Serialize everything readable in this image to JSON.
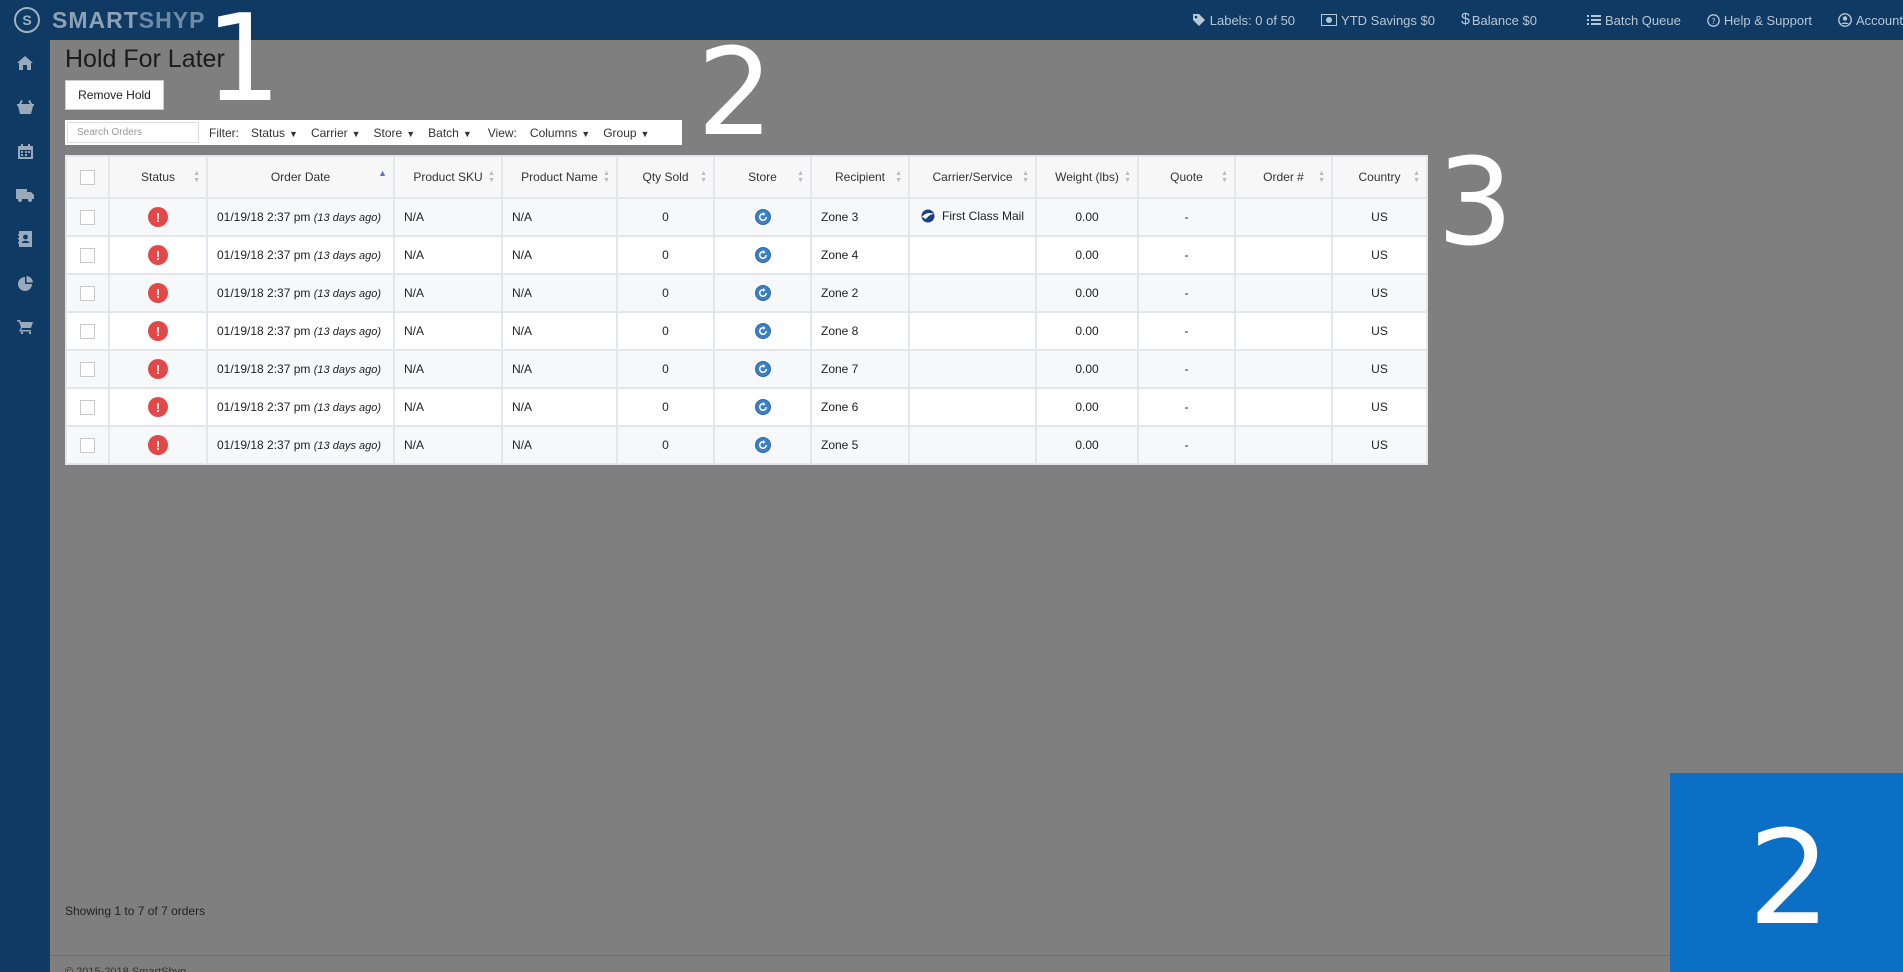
{
  "app": {
    "logo_word1": "SMART",
    "logo_word2": "SHYP"
  },
  "topbar": {
    "labels": "Labels: 0 of 50",
    "ytd_savings": "YTD Savings $0",
    "balance": "Balance $0",
    "batch_queue": "Batch Queue",
    "help": "Help & Support",
    "account": "Account"
  },
  "sidenav": {
    "items": [
      "home-icon",
      "basket-icon",
      "calendar-icon",
      "truck-icon",
      "contacts-icon",
      "pie-chart-icon",
      "cart-icon"
    ]
  },
  "page": {
    "title": "Hold For Later",
    "remove_hold": "Remove Hold"
  },
  "filter": {
    "search_placeholder": "Search Orders",
    "filter_label": "Filter:",
    "status": "Status",
    "carrier": "Carrier",
    "store": "Store",
    "batch": "Batch",
    "view_label": "View:",
    "columns": "Columns",
    "group": "Group"
  },
  "table": {
    "headers": [
      "Status",
      "Order Date",
      "Product SKU",
      "Product Name",
      "Qty Sold",
      "Store",
      "Recipient",
      "Carrier/Service",
      "Weight (lbs)",
      "Quote",
      "Order #",
      "Country"
    ],
    "rows": [
      {
        "date": "01/19/18 2:37 pm",
        "ago": "(13 days ago)",
        "sku": "N/A",
        "name": "N/A",
        "qty": "0",
        "recipient": "Zone 3",
        "carrier": "First Class Mail",
        "weight": "0.00",
        "quote": "-",
        "order": "",
        "country": "US"
      },
      {
        "date": "01/19/18 2:37 pm",
        "ago": "(13 days ago)",
        "sku": "N/A",
        "name": "N/A",
        "qty": "0",
        "recipient": "Zone 4",
        "carrier": "",
        "weight": "0.00",
        "quote": "-",
        "order": "",
        "country": "US"
      },
      {
        "date": "01/19/18 2:37 pm",
        "ago": "(13 days ago)",
        "sku": "N/A",
        "name": "N/A",
        "qty": "0",
        "recipient": "Zone 2",
        "carrier": "",
        "weight": "0.00",
        "quote": "-",
        "order": "",
        "country": "US"
      },
      {
        "date": "01/19/18 2:37 pm",
        "ago": "(13 days ago)",
        "sku": "N/A",
        "name": "N/A",
        "qty": "0",
        "recipient": "Zone 8",
        "carrier": "",
        "weight": "0.00",
        "quote": "-",
        "order": "",
        "country": "US"
      },
      {
        "date": "01/19/18 2:37 pm",
        "ago": "(13 days ago)",
        "sku": "N/A",
        "name": "N/A",
        "qty": "0",
        "recipient": "Zone 7",
        "carrier": "",
        "weight": "0.00",
        "quote": "-",
        "order": "",
        "country": "US"
      },
      {
        "date": "01/19/18 2:37 pm",
        "ago": "(13 days ago)",
        "sku": "N/A",
        "name": "N/A",
        "qty": "0",
        "recipient": "Zone 6",
        "carrier": "",
        "weight": "0.00",
        "quote": "-",
        "order": "",
        "country": "US"
      },
      {
        "date": "01/19/18 2:37 pm",
        "ago": "(13 days ago)",
        "sku": "N/A",
        "name": "N/A",
        "qty": "0",
        "recipient": "Zone 5",
        "carrier": "",
        "weight": "0.00",
        "quote": "-",
        "order": "",
        "country": "US"
      }
    ]
  },
  "footer": {
    "showing": "Showing 1 to 7 of 7 orders",
    "copyright": "© 2015-2018 SmartShyp"
  },
  "overlays": {
    "n1": "1",
    "n2": "2",
    "n3": "3",
    "box": "2"
  },
  "colors": {
    "topbar": "#0e3a63",
    "backdrop": "#7f7f7f",
    "status_error": "#e24848",
    "overlay_box": "#0b6fc6"
  }
}
